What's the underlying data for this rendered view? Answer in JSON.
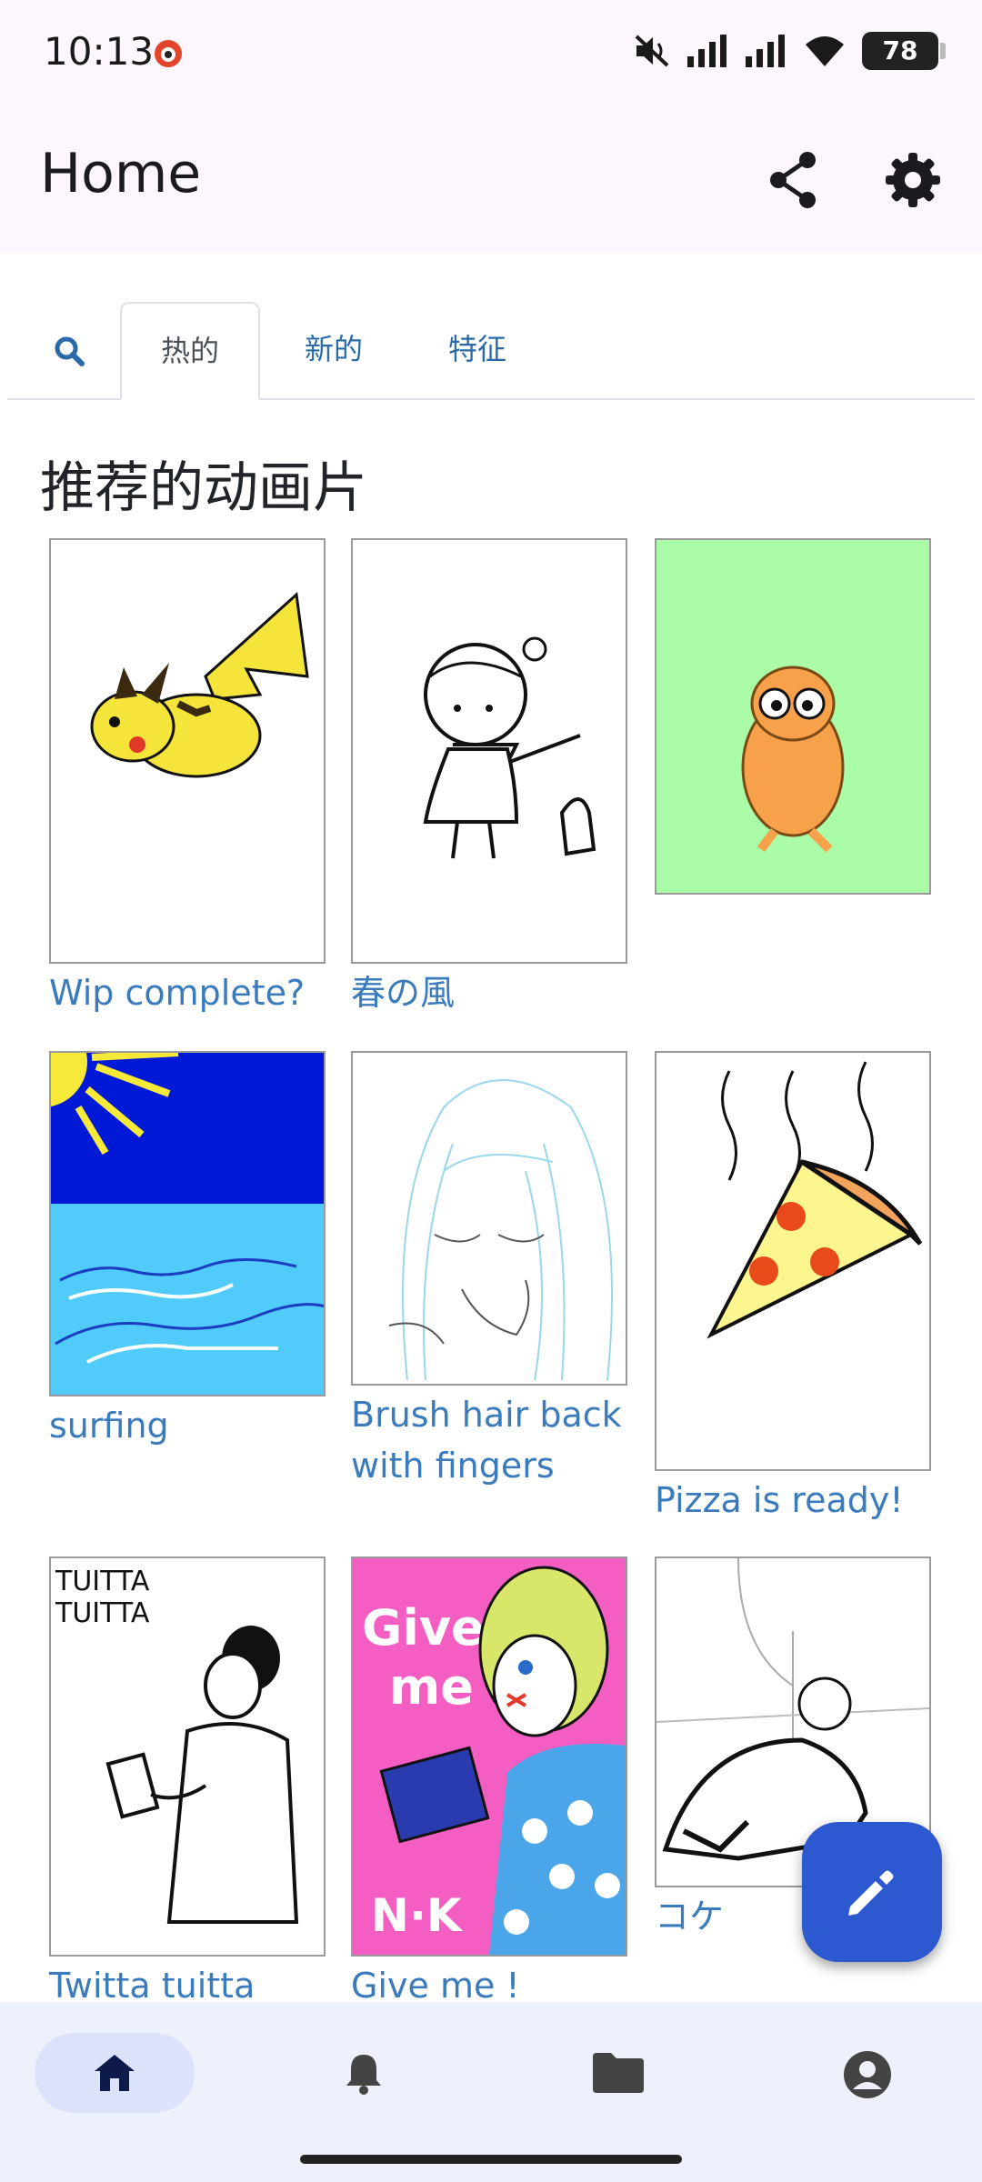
{
  "status_bar": {
    "time": "10:13",
    "battery": "78",
    "icons": [
      "app-notification-icon",
      "mute-icon",
      "signal-icon",
      "signal-icon",
      "wifi-icon",
      "battery-icon"
    ]
  },
  "app_bar": {
    "title": "Home",
    "actions": [
      "share-icon",
      "settings-icon"
    ]
  },
  "tabs": [
    {
      "label": "",
      "icon": "search-icon"
    },
    {
      "label": "热的",
      "active": true
    },
    {
      "label": "新的"
    },
    {
      "label": "特征"
    }
  ],
  "section_title": "推荐的动画片",
  "cards": [
    {
      "title": "Wip complete?",
      "art": "pikachu drawing"
    },
    {
      "title": "春の風",
      "art": "girl with scarf"
    },
    {
      "title": "",
      "art": "orange creature on green"
    },
    {
      "title": "surfing",
      "art": "sun and sea"
    },
    {
      "title": "Brush hair back with fingers",
      "art": "girl with long hair"
    },
    {
      "title": "Pizza is ready!",
      "art": "pizza slice"
    },
    {
      "title": "Twitta tuitta",
      "art": "man with phone",
      "art_text": [
        "TUITTA",
        "TUITTA"
      ]
    },
    {
      "title": "Give me !",
      "art": "girl with chocolate",
      "art_text": [
        "Give",
        "me",
        "N·K"
      ]
    },
    {
      "title": "コケ",
      "art": "falling figure sketch"
    }
  ],
  "fab": {
    "icon": "edit-pencil-icon"
  },
  "bottom_nav": [
    {
      "icon": "home-icon",
      "active": true
    },
    {
      "icon": "bell-icon"
    },
    {
      "icon": "folder-icon"
    },
    {
      "icon": "account-icon"
    }
  ],
  "colors": {
    "accent": "#2c59cf",
    "link": "#3a7bbd",
    "appbar_bg": "#fdf6fd",
    "navbar_bg": "#eef0fb"
  }
}
